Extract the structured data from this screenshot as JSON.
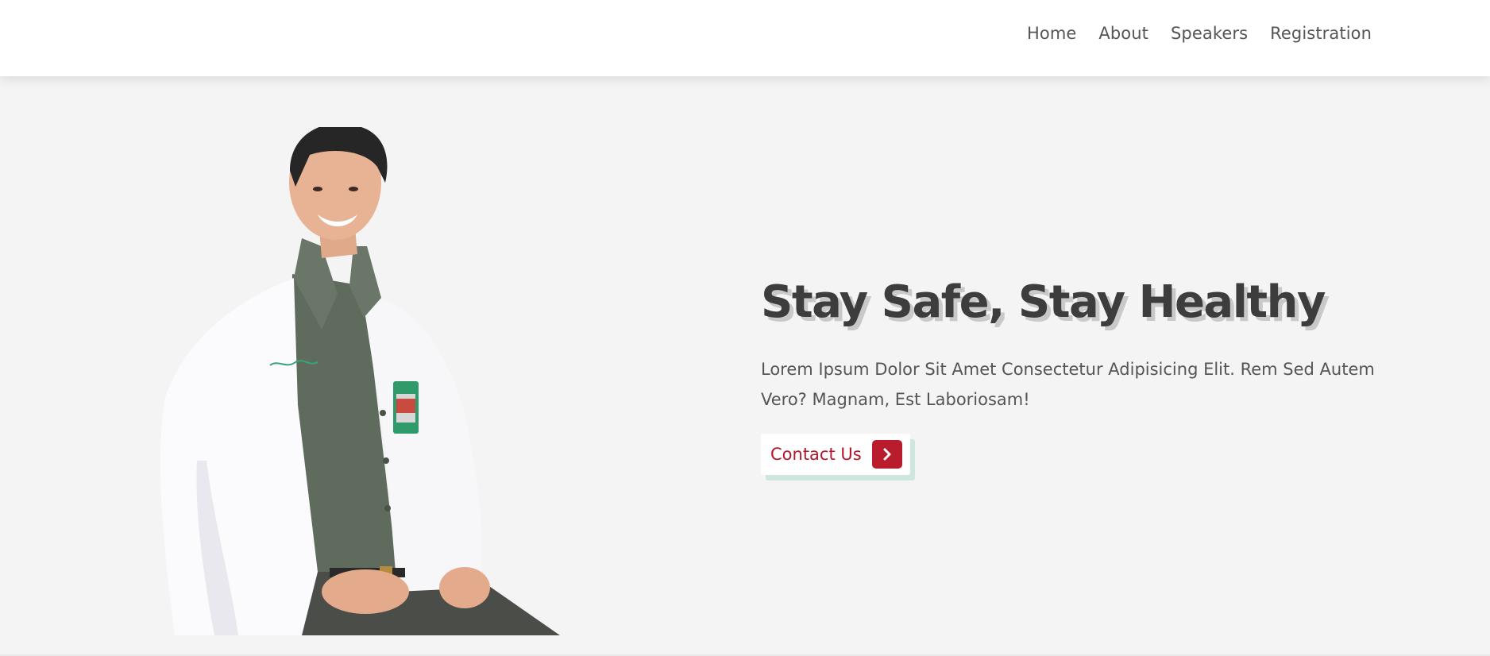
{
  "nav": {
    "items": [
      {
        "label": "Home"
      },
      {
        "label": "About"
      },
      {
        "label": "Speakers"
      },
      {
        "label": "Registration"
      }
    ]
  },
  "hero": {
    "title": "Stay Safe, Stay Healthy",
    "text": "Lorem Ipsum Dolor Sit Amet Consectetur Adipisicing Elit. Rem Sed Autem Vero? Magnam, Est Laboriosam!",
    "cta_label": "Contact Us",
    "cta_icon": "chevron-right-icon"
  },
  "colors": {
    "background": "#f4f4f4",
    "navbar": "#ffffff",
    "title": "#3d3d3d",
    "accent": "#b91c2c",
    "button_shadow": "#cfe6de"
  }
}
